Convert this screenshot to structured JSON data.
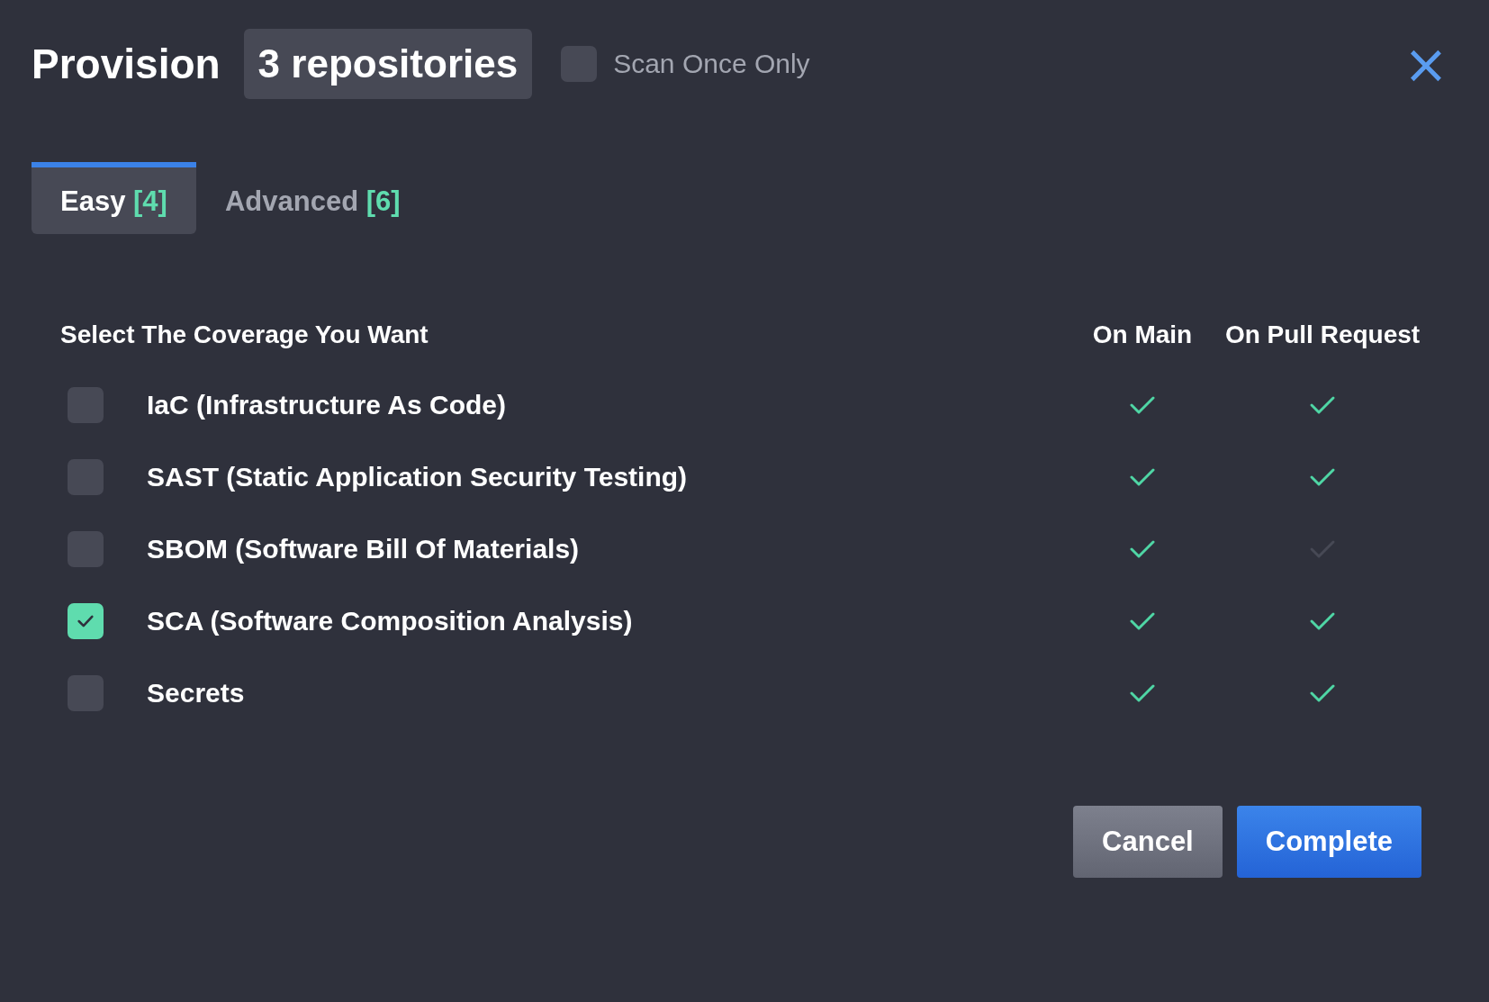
{
  "header": {
    "title": "Provision",
    "badge": "3 repositories",
    "scan_once": {
      "label": "Scan Once Only",
      "checked": false
    },
    "close": "×"
  },
  "tabs": [
    {
      "label": "Easy",
      "count": "[4]",
      "selected": true
    },
    {
      "label": "Advanced",
      "count": "[6]",
      "selected": false
    }
  ],
  "table": {
    "columns": [
      "Select The Coverage You Want",
      "On Main",
      "On Pull Request"
    ],
    "rows": [
      {
        "name": "IaC (Infrastructure As Code)",
        "checked": false,
        "on_main": true,
        "on_pull_request": true
      },
      {
        "name": "SAST (Static Application Security Testing)",
        "checked": false,
        "on_main": true,
        "on_pull_request": true
      },
      {
        "name": "SBOM (Software Bill Of Materials)",
        "checked": false,
        "on_main": true,
        "on_pull_request": false
      },
      {
        "name": "SCA (Software Composition Analysis)",
        "checked": true,
        "on_main": true,
        "on_pull_request": true
      },
      {
        "name": "Secrets",
        "checked": false,
        "on_main": true,
        "on_pull_request": true
      }
    ]
  },
  "buttons": [
    {
      "label": "Cancel",
      "kind": "secondary"
    },
    {
      "label": "Complete",
      "kind": "primary"
    }
  ]
}
